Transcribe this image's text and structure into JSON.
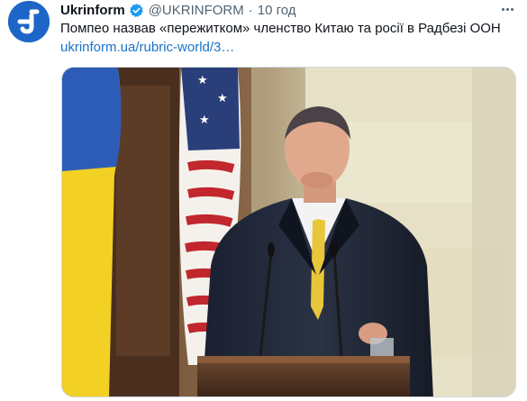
{
  "tweet": {
    "author_name": "Ukrinform",
    "handle": "@UKRINFORM",
    "separator": "·",
    "time": "10 год",
    "text": "Помпео назвав «пережитком» членство Китаю та росії в Радбезі ООН",
    "link": "ukrinform.ua/rubric-world/3…",
    "avatar_icon": "ukrinform-logo-icon",
    "verified_icon": "verified-badge-icon",
    "more_icon": "more-options-icon",
    "colors": {
      "avatar_bg": "#1d66c8",
      "verified": "#1d9bf0",
      "link": "#1b72c7",
      "muted": "#536471"
    }
  }
}
